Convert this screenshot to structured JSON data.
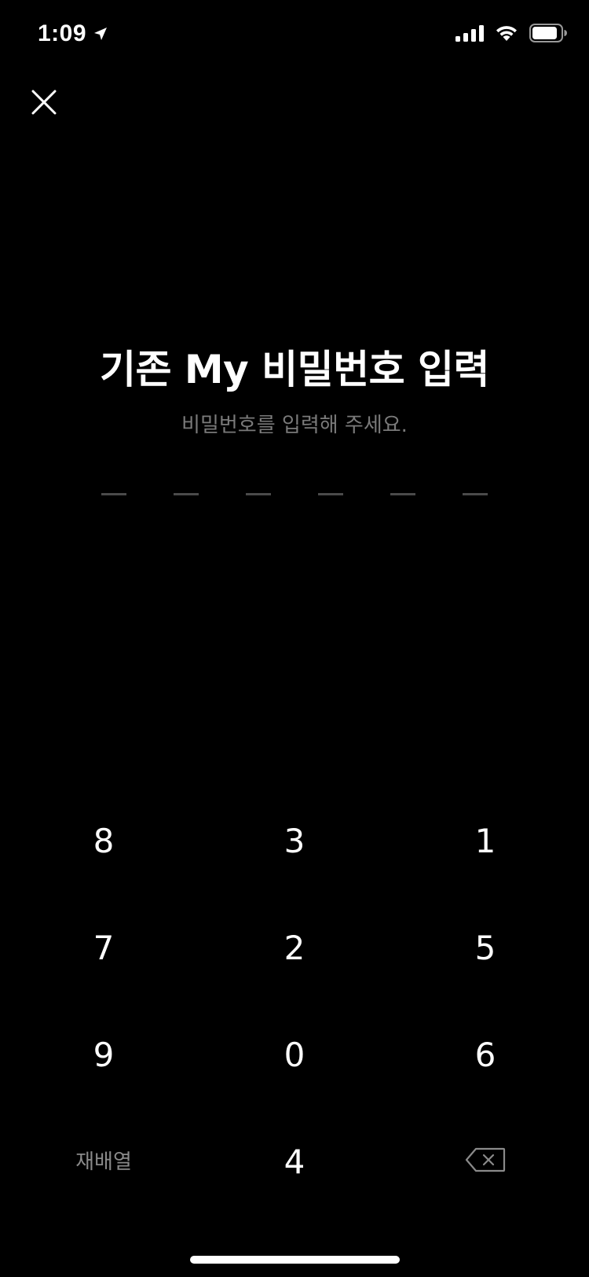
{
  "status_bar": {
    "time": "1:09",
    "location_icon": "location-arrow-icon",
    "signal_icon": "cellular-signal-icon",
    "wifi_icon": "wifi-icon",
    "battery_icon": "battery-icon"
  },
  "header": {
    "close_icon": "close-icon"
  },
  "content": {
    "title": "기존 My 비밀번호 입력",
    "subtitle": "비밀번호를 입력해 주세요.",
    "pin_length": 6
  },
  "keypad": {
    "keys": [
      "8",
      "3",
      "1",
      "7",
      "2",
      "5",
      "9",
      "0",
      "6"
    ],
    "rearrange_label": "재배열",
    "last_digit": "4",
    "backspace_icon": "backspace-icon"
  },
  "colors": {
    "background": "#000000",
    "text": "#ffffff",
    "muted": "#7a7a7a",
    "dash": "#4a4a4a"
  }
}
